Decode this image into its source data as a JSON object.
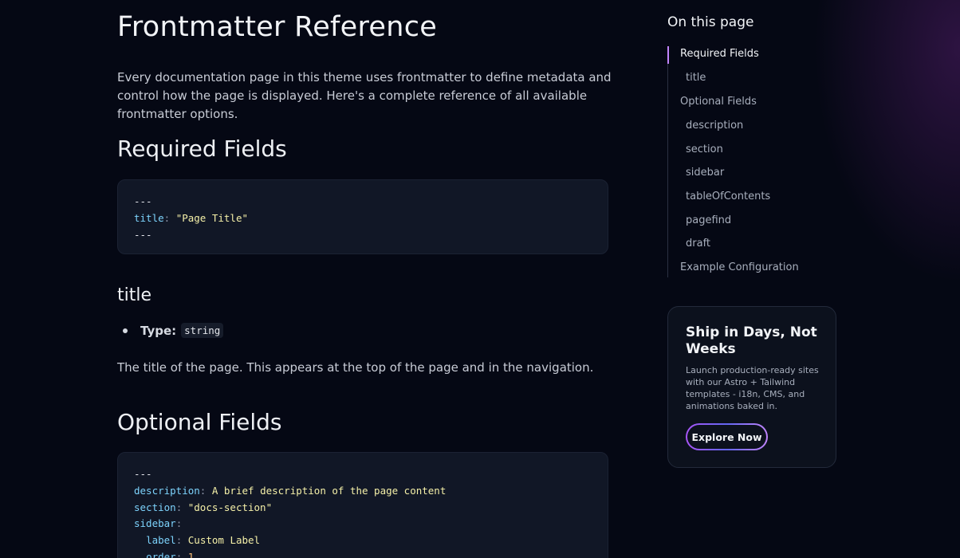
{
  "page": {
    "title": "Frontmatter Reference",
    "intro": "Every documentation page in this theme uses frontmatter to define metadata and control how the page is displayed. Here's a complete reference of all available frontmatter options."
  },
  "sections": {
    "required_heading": "Required Fields",
    "required_code": {
      "line1": "---",
      "key": "title",
      "value": "\"Page Title\"",
      "line3": "---"
    },
    "title_heading": "title",
    "title_type_label": "Type:",
    "title_type_value": "string",
    "title_description": "The title of the page. This appears at the top of the page and in the navigation.",
    "optional_heading": "Optional Fields",
    "optional_code": {
      "l1": "---",
      "l2_key": "description",
      "l2_val": "A brief description of the page content",
      "l3_key": "section",
      "l3_val": "\"docs-section\"",
      "l4_key": "sidebar",
      "l5_key": "label",
      "l5_val": "Custom Label",
      "l6_key": "order",
      "l6_val": "1"
    }
  },
  "toc": {
    "title": "On this page",
    "items": [
      {
        "label": "Required Fields"
      },
      {
        "label": "title"
      },
      {
        "label": "Optional Fields"
      },
      {
        "label": "description"
      },
      {
        "label": "section"
      },
      {
        "label": "sidebar"
      },
      {
        "label": "tableOfContents"
      },
      {
        "label": "pagefind"
      },
      {
        "label": "draft"
      },
      {
        "label": "Example Configuration"
      }
    ]
  },
  "promo": {
    "title": "Ship in Days, Not Weeks",
    "text": "Launch production-ready sites with our Astro + Tailwind templates - i18n, CMS, and animations baked in.",
    "button": "Explore Now"
  },
  "colors": {
    "background": "#050814",
    "code_bg": "#111726",
    "accent": "#a855f7",
    "code_key": "#7dd3fc",
    "code_string": "#f5f0a8"
  }
}
